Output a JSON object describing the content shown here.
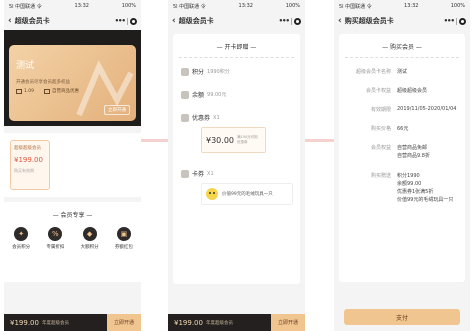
{
  "status": {
    "carrier": "5l 中国联通 令",
    "time": "13:32",
    "battery": "100%"
  },
  "screen1": {
    "nav_title": "超级会员卡",
    "card": {
      "name": "测试",
      "desc": "开通会员尽享会员超多权益",
      "points_prefix": "积分",
      "points_value": "1.09",
      "coupon_text": "自营商品优惠",
      "open_btn": "立即开通"
    },
    "member_card": {
      "label": "超级超级会员",
      "price": "¥199.00",
      "validity": "购买有效期"
    },
    "benefits": {
      "title": "会员专享",
      "items": [
        {
          "label": "会员积分",
          "icon": "gift-icon"
        },
        {
          "label": "专属折扣",
          "icon": "discount-icon"
        },
        {
          "label": "大额积分",
          "icon": "points-icon"
        },
        {
          "label": "券额红包",
          "icon": "redpacket-icon"
        }
      ]
    },
    "bottom": {
      "price": "¥199.00",
      "note": "年度超级会员",
      "btn": "立即开通"
    }
  },
  "screen2": {
    "nav_title": "超级会员卡",
    "gift_title": "开卡即赠",
    "points": {
      "label": "积分",
      "value": "1990积分"
    },
    "balance": {
      "label": "余额",
      "value": "99.00元"
    },
    "coupon": {
      "label": "优惠券",
      "count": "X1",
      "amount": "¥30.00",
      "desc": "满100元可用 优惠券"
    },
    "card_coupon": {
      "label": "卡券",
      "count": "X1",
      "item_text": "价值99元的毛绒玩具一只"
    },
    "bottom": {
      "price": "¥199.00",
      "note": "年度超级会员",
      "btn": "立即开通"
    }
  },
  "screen3": {
    "nav_title": "购买超级会员卡",
    "section_title": "购买会员",
    "rows": [
      {
        "label": "超级会员卡名称",
        "value": "测试"
      },
      {
        "label": "会员卡权益",
        "value": "超级超级会员"
      },
      {
        "label": "有效期限",
        "value": "2019/11/05-2020/01/04"
      },
      {
        "label": "购买价格",
        "value": "66元"
      },
      {
        "label": "会员权益",
        "value": "自营商品免邮\n自营商品9.8折"
      },
      {
        "label": "购买赠送",
        "value": "积分1990\n余额99.00\n优惠券1张满5折\n价值99元的毛绒玩具一只"
      }
    ],
    "pay_btn": "支付"
  },
  "colors": {
    "gold": "#e9bf8b",
    "dark": "#23201f",
    "accent_red": "#e0553f"
  }
}
